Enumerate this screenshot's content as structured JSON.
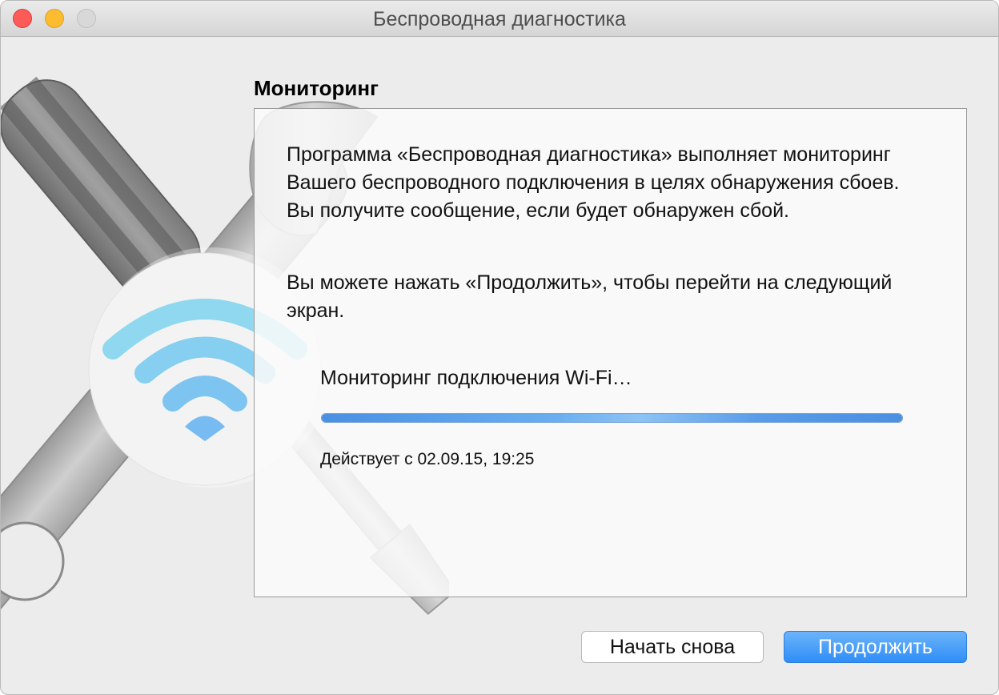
{
  "window": {
    "title": "Беспроводная диагностика"
  },
  "section": {
    "title": "Мониторинг"
  },
  "panel": {
    "paragraph1": "Программа «Беспроводная диагностика» выполняет мониторинг Вашего беспроводного подключения в целях обнаружения сбоев. Вы получите сообщение, если будет обнаружен сбой.",
    "paragraph2": "Вы можете нажать «Продолжить», чтобы перейти на следующий экран.",
    "status_label": "Мониторинг подключения Wi‑Fi…",
    "since_text": "Действует с 02.09.15, 19:25",
    "progress_fraction": 1.0
  },
  "buttons": {
    "restart_label": "Начать снова",
    "continue_label": "Продолжить"
  },
  "icons": [
    "wifi-icon",
    "wrench-icon",
    "screwdriver-icon"
  ],
  "colors": {
    "accent": "#3d8ff0",
    "wifi": "#8fd8ef",
    "close": "#fc5b57",
    "minimize": "#fdbb2f",
    "zoom": "#d8d8d8"
  }
}
